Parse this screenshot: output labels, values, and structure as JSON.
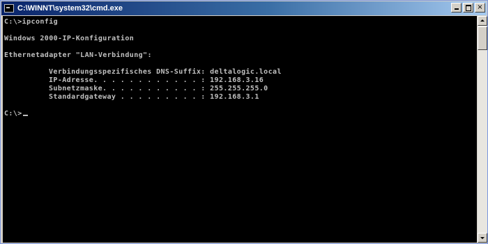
{
  "window": {
    "title": "C:\\WINNT\\system32\\cmd.exe",
    "controls": {
      "minimize": "_",
      "maximize": "□",
      "close": "×"
    }
  },
  "console": {
    "prompt_command": "C:\\>ipconfig",
    "header": "Windows 2000-IP-Konfiguration",
    "adapter": "Ethernetadapter \"LAN-Verbindung\":",
    "entries": [
      {
        "label": "Verbindungsspezifisches DNS-Suffix:",
        "value": "deltalogic.local"
      },
      {
        "label": "IP-Adresse. . . . . . . . . . . . :",
        "value": "192.168.3.16"
      },
      {
        "label": "Subnetzmaske. . . . . . . . . . . :",
        "value": "255.255.255.0"
      },
      {
        "label": "Standardgateway . . . . . . . . . :",
        "value": "192.168.3.1"
      }
    ],
    "final_prompt": "C:\\>"
  },
  "colors": {
    "console_background": "#000000",
    "console_text": "#c0c0c0",
    "titlebar_start": "#0a246a",
    "titlebar_end": "#a6caf0"
  },
  "icons": {
    "window_icon": "cmd-window-icon"
  }
}
